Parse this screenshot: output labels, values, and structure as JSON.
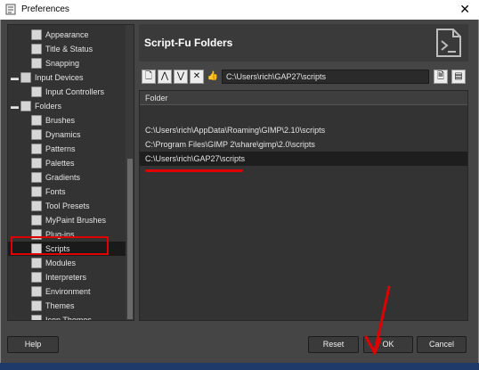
{
  "window": {
    "title": "Preferences",
    "close_glyph": "✕"
  },
  "sidebar": {
    "items": [
      {
        "label": "Appearance",
        "icon": "appearance-icon",
        "level": 1,
        "expander": ""
      },
      {
        "label": "Title & Status",
        "icon": "title-status-icon",
        "level": 1,
        "expander": ""
      },
      {
        "label": "Snapping",
        "icon": "snapping-icon",
        "level": 1,
        "expander": ""
      },
      {
        "label": "Input Devices",
        "icon": "input-devices-icon",
        "level": 0,
        "expander": "▬"
      },
      {
        "label": "Input Controllers",
        "icon": "input-controllers-icon",
        "level": 1,
        "expander": ""
      },
      {
        "label": "Folders",
        "icon": "folders-icon",
        "level": 0,
        "expander": "▬"
      },
      {
        "label": "Brushes",
        "icon": "brushes-icon",
        "level": 1,
        "expander": ""
      },
      {
        "label": "Dynamics",
        "icon": "dynamics-icon",
        "level": 1,
        "expander": ""
      },
      {
        "label": "Patterns",
        "icon": "patterns-icon",
        "level": 1,
        "expander": ""
      },
      {
        "label": "Palettes",
        "icon": "palettes-icon",
        "level": 1,
        "expander": ""
      },
      {
        "label": "Gradients",
        "icon": "gradients-icon",
        "level": 1,
        "expander": ""
      },
      {
        "label": "Fonts",
        "icon": "fonts-icon",
        "level": 1,
        "expander": ""
      },
      {
        "label": "Tool Presets",
        "icon": "tool-presets-icon",
        "level": 1,
        "expander": ""
      },
      {
        "label": "MyPaint Brushes",
        "icon": "mypaint-brushes-icon",
        "level": 1,
        "expander": ""
      },
      {
        "label": "Plug-ins",
        "icon": "plugins-icon",
        "level": 1,
        "expander": ""
      },
      {
        "label": "Scripts",
        "icon": "scripts-icon",
        "level": 1,
        "expander": "",
        "selected": true
      },
      {
        "label": "Modules",
        "icon": "modules-icon",
        "level": 1,
        "expander": ""
      },
      {
        "label": "Interpreters",
        "icon": "interpreters-icon",
        "level": 1,
        "expander": ""
      },
      {
        "label": "Environment",
        "icon": "environment-icon",
        "level": 1,
        "expander": ""
      },
      {
        "label": "Themes",
        "icon": "themes-icon",
        "level": 1,
        "expander": ""
      },
      {
        "label": "Icon Themes",
        "icon": "icon-themes-icon",
        "level": 1,
        "expander": ""
      }
    ]
  },
  "panel": {
    "title": "Script-Fu Folders",
    "header_icon": "script-terminal-icon",
    "toolbar": {
      "buttons": [
        {
          "name": "add-folder-button",
          "icon": "new-document-icon",
          "glyph": "🗋"
        },
        {
          "name": "move-up-button",
          "icon": "arrow-up-icon",
          "glyph": "⋀"
        },
        {
          "name": "move-down-button",
          "icon": "arrow-down-icon",
          "glyph": "⋁"
        },
        {
          "name": "delete-folder-button",
          "icon": "delete-icon",
          "glyph": "✕"
        },
        {
          "name": "writable-toggle-button",
          "icon": "thumbs-up-icon",
          "glyph": "👍"
        }
      ],
      "path_value": "C:\\Users\\rich\\GAP27\\scripts",
      "browse_glyph": "🗎",
      "save_glyph": "▤"
    },
    "list": {
      "column_header": "Folder",
      "rows": [
        {
          "path": "C:\\Users\\rich\\AppData\\Roaming\\GIMP\\2.10\\scripts",
          "selected": false
        },
        {
          "path": "C:\\Program Files\\GIMP 2\\share\\gimp\\2.0\\scripts",
          "selected": false
        },
        {
          "path": "C:\\Users\\rich\\GAP27\\scripts",
          "selected": true
        }
      ]
    }
  },
  "footer": {
    "help_label": "Help",
    "reset_label": "Reset",
    "ok_label": "OK",
    "cancel_label": "Cancel"
  },
  "colors": {
    "dialog_bg": "#454545",
    "list_bg": "#333333",
    "selection_bg": "#1e1e1e",
    "annotation_red": "#e00000"
  }
}
